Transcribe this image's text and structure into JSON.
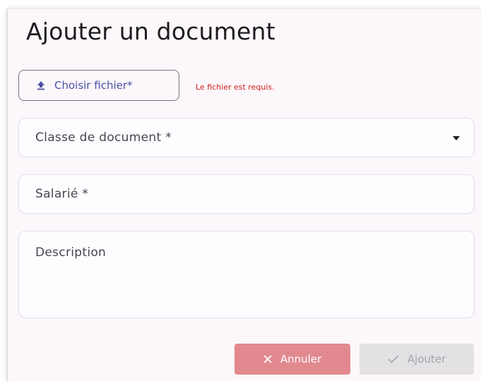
{
  "dialog": {
    "title": "Ajouter un document"
  },
  "upload": {
    "label": "Choisir fichier*",
    "icon": "upload-icon",
    "error": "Le fichier est requis."
  },
  "fields": {
    "document_class_label": "Classe de document  *",
    "employee_label": "Salarié  *",
    "description_label": "Description"
  },
  "actions": {
    "cancel_label": "Annuler",
    "cancel_icon": "close-icon",
    "add_label": "Ajouter",
    "add_icon": "check-icon"
  },
  "colors": {
    "accent": "#4a4fa3",
    "error": "#d21f1f",
    "cancel_bg": "#e1898f",
    "disabled_bg": "#e3e1e4"
  }
}
